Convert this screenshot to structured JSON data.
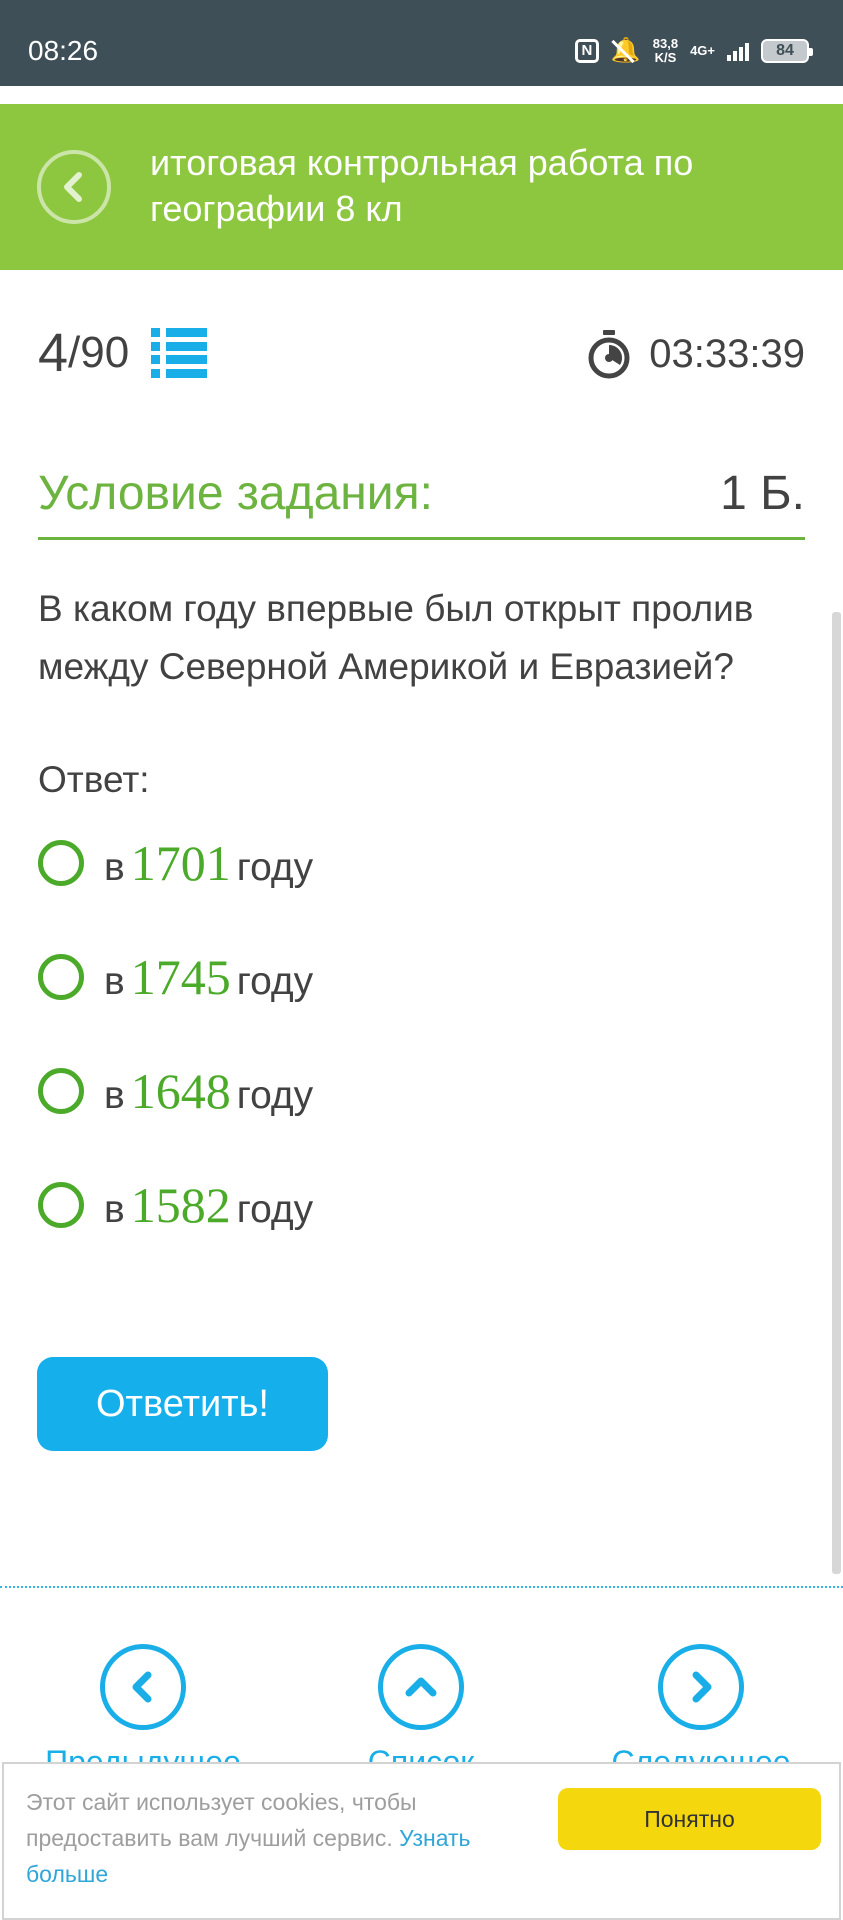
{
  "status_bar": {
    "time": "08:26",
    "nfc": "N",
    "speed_value": "83,8",
    "speed_unit": "K/S",
    "network": "4G+",
    "battery": "84"
  },
  "header": {
    "title": "итоговая контрольная работа по географии 8 кл",
    "back_icon": "chevron-left-icon",
    "color": "#8dc63f"
  },
  "progress": {
    "current": "4",
    "total": "/90",
    "list_icon": "list-icon"
  },
  "timer": {
    "icon": "stopwatch-icon",
    "value": "03:33:39"
  },
  "task": {
    "title": "Условие задания:",
    "points": "1 Б.",
    "question": "В каком году впервые был открыт пролив между Северной Америкой и Евразией?",
    "answer_label": "Ответ:"
  },
  "options": [
    {
      "prefix": "в",
      "year": "1701",
      "suffix": "году"
    },
    {
      "prefix": "в",
      "year": "1745",
      "suffix": "году"
    },
    {
      "prefix": "в",
      "year": "1648",
      "suffix": "году"
    },
    {
      "prefix": "в",
      "year": "1582",
      "suffix": "году"
    }
  ],
  "submit_label": "Ответить!",
  "nav": {
    "prev_label": "Предыдущее",
    "list_label": "Список",
    "next_label": "Следующее"
  },
  "cookie": {
    "text": "Этот сайт использует cookies, чтобы предоставить вам лучший сервис.",
    "link": "Узнать больше",
    "button": "Понятно"
  },
  "colors": {
    "accent_blue": "#19aee8",
    "accent_green": "#6cb33f",
    "cookie_button": "#f4d70d",
    "status_bar": "#3f4f57"
  }
}
